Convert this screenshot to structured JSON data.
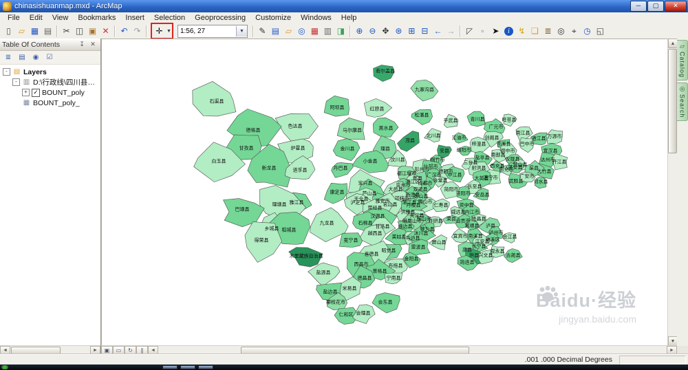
{
  "window": {
    "title": "chinasishuanmap.mxd - ArcMap",
    "controls": [
      {
        "name": "minimize-button",
        "glyph": "─"
      },
      {
        "name": "maximize-button",
        "glyph": "▢"
      },
      {
        "name": "close-button",
        "glyph": "✕"
      }
    ]
  },
  "menu": {
    "items": [
      "File",
      "Edit",
      "View",
      "Bookmarks",
      "Insert",
      "Selection",
      "Geoprocessing",
      "Customize",
      "Windows",
      "Help"
    ]
  },
  "toolbar": {
    "scale_value": "1:56, 27",
    "highlight_color": "#e02020",
    "groups": [
      [
        {
          "n": "new-document",
          "g": "▯",
          "c": "#555"
        },
        {
          "n": "open-folder",
          "g": "▱",
          "c": "#d99b2b"
        },
        {
          "n": "save",
          "g": "▦",
          "c": "#2458c8"
        },
        {
          "n": "print",
          "g": "▤",
          "c": "#666"
        }
      ],
      [
        {
          "n": "cut",
          "g": "✂",
          "c": "#444"
        },
        {
          "n": "copy",
          "g": "◫",
          "c": "#444"
        },
        {
          "n": "paste",
          "g": "▣",
          "c": "#a8742f"
        },
        {
          "n": "delete",
          "g": "✕",
          "c": "#cc3333"
        }
      ],
      [
        {
          "n": "undo",
          "g": "↶",
          "c": "#2458c8"
        },
        {
          "n": "redo",
          "g": "↷",
          "c": "#9aa2ad"
        }
      ],
      [
        {
          "n": "add-data",
          "g": "✛",
          "c": "#111",
          "hl": true,
          "caret": true
        },
        {
          "n": "scale-combo",
          "combo": true
        }
      ],
      [
        {
          "n": "edit-pencil",
          "g": "✎",
          "c": "#333"
        },
        {
          "n": "table-of-contents-window",
          "g": "▤",
          "c": "#2458c8"
        },
        {
          "n": "catalog-window",
          "g": "▱",
          "c": "#d99b2b"
        },
        {
          "n": "search-window",
          "g": "◎",
          "c": "#2458c8"
        },
        {
          "n": "arctoolbox",
          "g": "▦",
          "c": "#cc3333"
        },
        {
          "n": "python-window",
          "g": "▥",
          "c": "#666"
        },
        {
          "n": "modelbuilder",
          "g": "◨",
          "c": "#3aa05a"
        }
      ],
      [
        {
          "n": "zoom-in",
          "g": "⊕",
          "c": "#1a56c4"
        },
        {
          "n": "zoom-out",
          "g": "⊖",
          "c": "#1a56c4"
        },
        {
          "n": "pan",
          "g": "✥",
          "c": "#333"
        },
        {
          "n": "full-extent",
          "g": "⊛",
          "c": "#1a56c4"
        },
        {
          "n": "fixed-zoom-in",
          "g": "⊞",
          "c": "#1a56c4"
        },
        {
          "n": "fixed-zoom-out",
          "g": "⊟",
          "c": "#1a56c4"
        },
        {
          "n": "go-back-extent",
          "g": "←",
          "c": "#1a56c4"
        },
        {
          "n": "go-forward-extent",
          "g": "→",
          "c": "#9aa2ad"
        }
      ],
      [
        {
          "n": "select-features",
          "g": "◸",
          "c": "#444"
        },
        {
          "n": "clear-selected-features",
          "g": "▫",
          "c": "#888"
        },
        {
          "n": "select-elements",
          "g": "➤",
          "c": "#111"
        },
        {
          "n": "identify",
          "g": "i",
          "c": "#fff",
          "badge": true
        },
        {
          "n": "hyperlink",
          "g": "↯",
          "c": "#d9a500"
        },
        {
          "n": "html-popup",
          "g": "❏",
          "c": "#d99b2b"
        },
        {
          "n": "measure",
          "g": "≣",
          "c": "#7b5c2e"
        },
        {
          "n": "find",
          "g": "◎",
          "c": "#333"
        },
        {
          "n": "go-to-xy",
          "g": "⌖",
          "c": "#333"
        },
        {
          "n": "time-slider",
          "g": "◷",
          "c": "#1a56c4"
        },
        {
          "n": "viewer-window",
          "g": "◱",
          "c": "#444"
        }
      ]
    ]
  },
  "toc": {
    "title": "Table Of Contents",
    "header_buttons": [
      {
        "name": "pin-icon",
        "glyph": "↧"
      },
      {
        "name": "close-icon",
        "glyph": "✕"
      }
    ],
    "toolbar_buttons": [
      {
        "name": "list-by-drawing-order",
        "glyph": "≣"
      },
      {
        "name": "list-by-source",
        "glyph": "▤"
      },
      {
        "name": "list-by-visibility",
        "glyph": "◉"
      },
      {
        "name": "list-by-selection",
        "glyph": "☑"
      }
    ],
    "tree": [
      {
        "indent": 0,
        "expander": "-",
        "icon": "layers",
        "icon_glyph": "▤",
        "icon_color": "#d9a13a",
        "label": "Layers",
        "bold": true
      },
      {
        "indent": 1,
        "expander": "-",
        "icon": "group",
        "icon_glyph": "▥",
        "icon_color": "#888",
        "label": "D:\\行政线\\四川县级行政区..."
      },
      {
        "indent": 2,
        "expander": "+",
        "checkbox": true,
        "checked": true,
        "label": "BOUNT_poly"
      },
      {
        "indent": 2,
        "icon": "table",
        "icon_glyph": "▦",
        "icon_color": "#7a8aa0",
        "label": "BOUNT_poly_"
      }
    ]
  },
  "side_tabs": [
    {
      "label": "Catalog",
      "icon": "catalog-icon",
      "glyph": "▱"
    },
    {
      "label": "Search",
      "icon": "search-icon",
      "glyph": "◎"
    }
  ],
  "view_buttons": [
    {
      "name": "data-view-button",
      "glyph": "▣"
    },
    {
      "name": "layout-view-button",
      "glyph": "▭"
    },
    {
      "name": "refresh-view-button",
      "glyph": "↻"
    },
    {
      "name": "pause-drawing-button",
      "glyph": "∥"
    }
  ],
  "status_bar": {
    "coordinates": ".001  .000 Decimal Degrees"
  },
  "watermark": {
    "brand": "Baidu·经验",
    "url": "jingyan.baidu.com"
  },
  "map": {
    "label_color": "#111111",
    "stroke_color": "#4a4a4a",
    "palette": [
      "#2f9e5f",
      "#49bd78",
      "#74d795",
      "#9fe8b4",
      "#57c985",
      "#37aa6b",
      "#83dba2",
      "#28935a",
      "#66cf8e",
      "#b2edc3",
      "#41b371",
      "#1f8a50",
      "#8fdfa6",
      "#35a565"
    ],
    "counties": [
      [
        "石渠县",
        167,
        90
      ],
      [
        "若尔盖县",
        412,
        46
      ],
      [
        "九寨沟县",
        469,
        73
      ],
      [
        "阿坝县",
        342,
        99
      ],
      [
        "红原县",
        400,
        101
      ],
      [
        "松潘县",
        465,
        110
      ],
      [
        "平武县",
        507,
        118
      ],
      [
        "青川县",
        546,
        116
      ],
      [
        "旺苍县",
        592,
        117
      ],
      [
        "广元市",
        573,
        127
      ],
      [
        "色达县",
        281,
        126
      ],
      [
        "德格县",
        220,
        132
      ],
      [
        "南江县",
        612,
        136
      ],
      [
        "通江县",
        635,
        144
      ],
      [
        "万源市",
        658,
        141
      ],
      [
        "黑水县",
        413,
        129
      ],
      [
        "马尔康县",
        364,
        132
      ],
      [
        "茂县",
        448,
        147
      ],
      [
        "北川县",
        482,
        140
      ],
      [
        "江油市",
        519,
        143
      ],
      [
        "剑阁县",
        567,
        143
      ],
      [
        "苍溪县",
        584,
        152
      ],
      [
        "巴中市",
        618,
        152
      ],
      [
        "甘孜县",
        210,
        158
      ],
      [
        "炉霍县",
        285,
        158
      ],
      [
        "金川县",
        357,
        159
      ],
      [
        "理县",
        412,
        159
      ],
      [
        "绵阳市",
        526,
        161
      ],
      [
        "梓潼县",
        548,
        152
      ],
      [
        "安县",
        498,
        162
      ],
      [
        "阆中市",
        590,
        162
      ],
      [
        "宣汉县",
        652,
        162
      ],
      [
        "白玉县",
        170,
        177
      ],
      [
        "新龙县",
        243,
        187
      ],
      [
        "道孚县",
        288,
        190
      ],
      [
        "小金县",
        390,
        177
      ],
      [
        "汶川县",
        430,
        175
      ],
      [
        "绵竹市",
        488,
        175
      ],
      [
        "三台县",
        536,
        179
      ],
      [
        "盐亭县",
        553,
        172
      ],
      [
        "南部县",
        576,
        168
      ],
      [
        "仪陇县",
        597,
        174
      ],
      [
        "营山县",
        608,
        182
      ],
      [
        "达州市",
        648,
        175
      ],
      [
        "开江县",
        665,
        178
      ],
      [
        "大竹县",
        643,
        192
      ],
      [
        "渠县",
        628,
        187
      ],
      [
        "西充县",
        575,
        184
      ],
      [
        "南充市",
        588,
        189
      ],
      [
        "蓬安县",
        601,
        186
      ],
      [
        "射洪县",
        548,
        187
      ],
      [
        "丹巴县",
        347,
        187
      ],
      [
        "彭州市",
        465,
        189
      ],
      [
        "什邡市",
        478,
        185
      ],
      [
        "都江堰市",
        443,
        195
      ],
      [
        "广汉市",
        483,
        197
      ],
      [
        "德阳市",
        500,
        192
      ],
      [
        "中江县",
        513,
        197
      ],
      [
        "金堂县",
        492,
        205
      ],
      [
        "成都市",
        470,
        209
      ],
      [
        "郫县",
        459,
        202
      ],
      [
        "武胜县",
        602,
        206
      ],
      [
        "广安市",
        618,
        199
      ],
      [
        "邻水县",
        638,
        207
      ],
      [
        "遂宁市",
        565,
        201
      ],
      [
        "大英县",
        552,
        202
      ],
      [
        "乐至县",
        542,
        214
      ],
      [
        "资阳市",
        525,
        224
      ],
      [
        "简阳市",
        508,
        218
      ],
      [
        "双流县",
        463,
        218
      ],
      [
        "温江区",
        452,
        207
      ],
      [
        "崇州市",
        438,
        212
      ],
      [
        "大邑县",
        427,
        218
      ],
      [
        "新津县",
        452,
        226
      ],
      [
        "邛崃市",
        436,
        231
      ],
      [
        "蒲江县",
        447,
        237
      ],
      [
        "眉山市",
        470,
        236
      ],
      [
        "彭山县",
        464,
        228
      ],
      [
        "仁寿县",
        493,
        241
      ],
      [
        "安岳县",
        553,
        226
      ],
      [
        "宝兴县",
        383,
        209
      ],
      [
        "芦山县",
        389,
        224
      ],
      [
        "天全县",
        377,
        232
      ],
      [
        "雅安市",
        408,
        235
      ],
      [
        "名山县",
        419,
        240
      ],
      [
        "康定县",
        342,
        222
      ],
      [
        "泸定县",
        372,
        237
      ],
      [
        "雅江县",
        283,
        237
      ],
      [
        "理塘县",
        258,
        240
      ],
      [
        "巴塘县",
        204,
        247
      ],
      [
        "荥经县",
        397,
        245
      ],
      [
        "汉源县",
        401,
        257
      ],
      [
        "洪雅县",
        445,
        251
      ],
      [
        "丹棱县",
        453,
        241
      ],
      [
        "夹江县",
        458,
        256
      ],
      [
        "乐山市",
        468,
        261
      ],
      [
        "峨眉山市",
        451,
        264
      ],
      [
        "资中县",
        530,
        241
      ],
      [
        "威远县",
        518,
        251
      ],
      [
        "内江市",
        538,
        251
      ],
      [
        "隆昌县",
        548,
        261
      ],
      [
        "自贡市",
        525,
        264
      ],
      [
        "荣县",
        508,
        261
      ],
      [
        "富顺县",
        538,
        271
      ],
      [
        "井研县",
        485,
        264
      ],
      [
        "犍为县",
        473,
        276
      ],
      [
        "九龙县",
        327,
        267
      ],
      [
        "石棉县",
        383,
        267
      ],
      [
        "甘洛县",
        408,
        272
      ],
      [
        "峨边县",
        441,
        272
      ],
      [
        "乡城县",
        247,
        275
      ],
      [
        "稻城县",
        272,
        277
      ],
      [
        "越西县",
        397,
        282
      ],
      [
        "美姑县",
        432,
        287
      ],
      [
        "马边县",
        452,
        289
      ],
      [
        "沐川县",
        464,
        282
      ],
      [
        "屏山县",
        490,
        295
      ],
      [
        "雷波县",
        460,
        302
      ],
      [
        "得荣县",
        232,
        292
      ],
      [
        "冕宁县",
        362,
        292
      ],
      [
        "木里藏族自治县",
        297,
        315
      ],
      [
        "昭觉县",
        417,
        307
      ],
      [
        "喜德县",
        392,
        312
      ],
      [
        "金阳县",
        450,
        319
      ],
      [
        "布拖县",
        427,
        329
      ],
      [
        "西昌市",
        377,
        327
      ],
      [
        "盐源县",
        322,
        339
      ],
      [
        "普格县",
        404,
        337
      ],
      [
        "宁南县",
        424,
        347
      ],
      [
        "德昌县",
        382,
        347
      ],
      [
        "泸县",
        565,
        271
      ],
      [
        "泸州市",
        573,
        281
      ],
      [
        "合江县",
        593,
        287
      ],
      [
        "纳溪区",
        568,
        291
      ],
      [
        "宜宾市",
        521,
        286
      ],
      [
        "南溪县",
        543,
        286
      ],
      [
        "江安县",
        553,
        294
      ],
      [
        "长宁县",
        548,
        301
      ],
      [
        "高县",
        531,
        306
      ],
      [
        "珙县",
        541,
        314
      ],
      [
        "兴文县",
        558,
        314
      ],
      [
        "筠连县",
        531,
        324
      ],
      [
        "叙永县",
        575,
        308
      ],
      [
        "古蔺县",
        598,
        314
      ],
      [
        "米易县",
        360,
        362
      ],
      [
        "盐边县",
        332,
        367
      ],
      [
        "攀枝花市",
        340,
        382
      ],
      [
        "仁和区",
        355,
        400
      ],
      [
        "会理县",
        380,
        398
      ],
      [
        "会东县",
        412,
        382
      ]
    ]
  }
}
